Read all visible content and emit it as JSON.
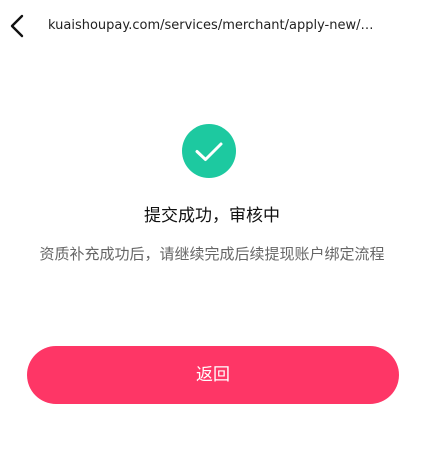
{
  "nav": {
    "url": "kuaishoupay.com/services/merchant/apply-new/…",
    "back_icon": "chevron-left-icon"
  },
  "result": {
    "icon": "check-circle-icon",
    "icon_color": "#1dc9a0",
    "title": "提交成功，审核中",
    "description": "资质补充成功后，请继续完成后续提现账户绑定流程"
  },
  "actions": {
    "return_label": "返回",
    "return_color": "#fe3666"
  }
}
